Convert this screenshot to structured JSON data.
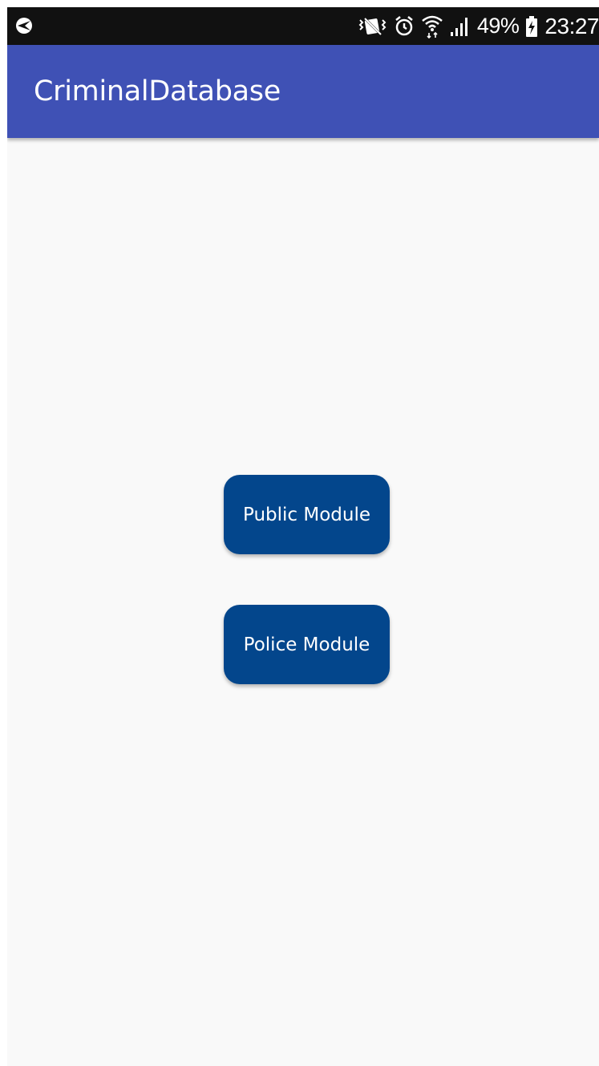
{
  "status_bar": {
    "left_icon": "app-notification-icon",
    "icons": [
      "vibrate-icon",
      "alarm-icon",
      "wifi-icon",
      "signal-icon"
    ],
    "battery_percent": "49%",
    "battery_icon": "battery-charging-icon",
    "time": "23:27"
  },
  "app_bar": {
    "title": "CriminalDatabase",
    "color": "#3f51b5"
  },
  "main": {
    "buttons": [
      {
        "label": "Public Module",
        "color": "#03468c"
      },
      {
        "label": "Police Module",
        "color": "#03468c"
      }
    ]
  }
}
